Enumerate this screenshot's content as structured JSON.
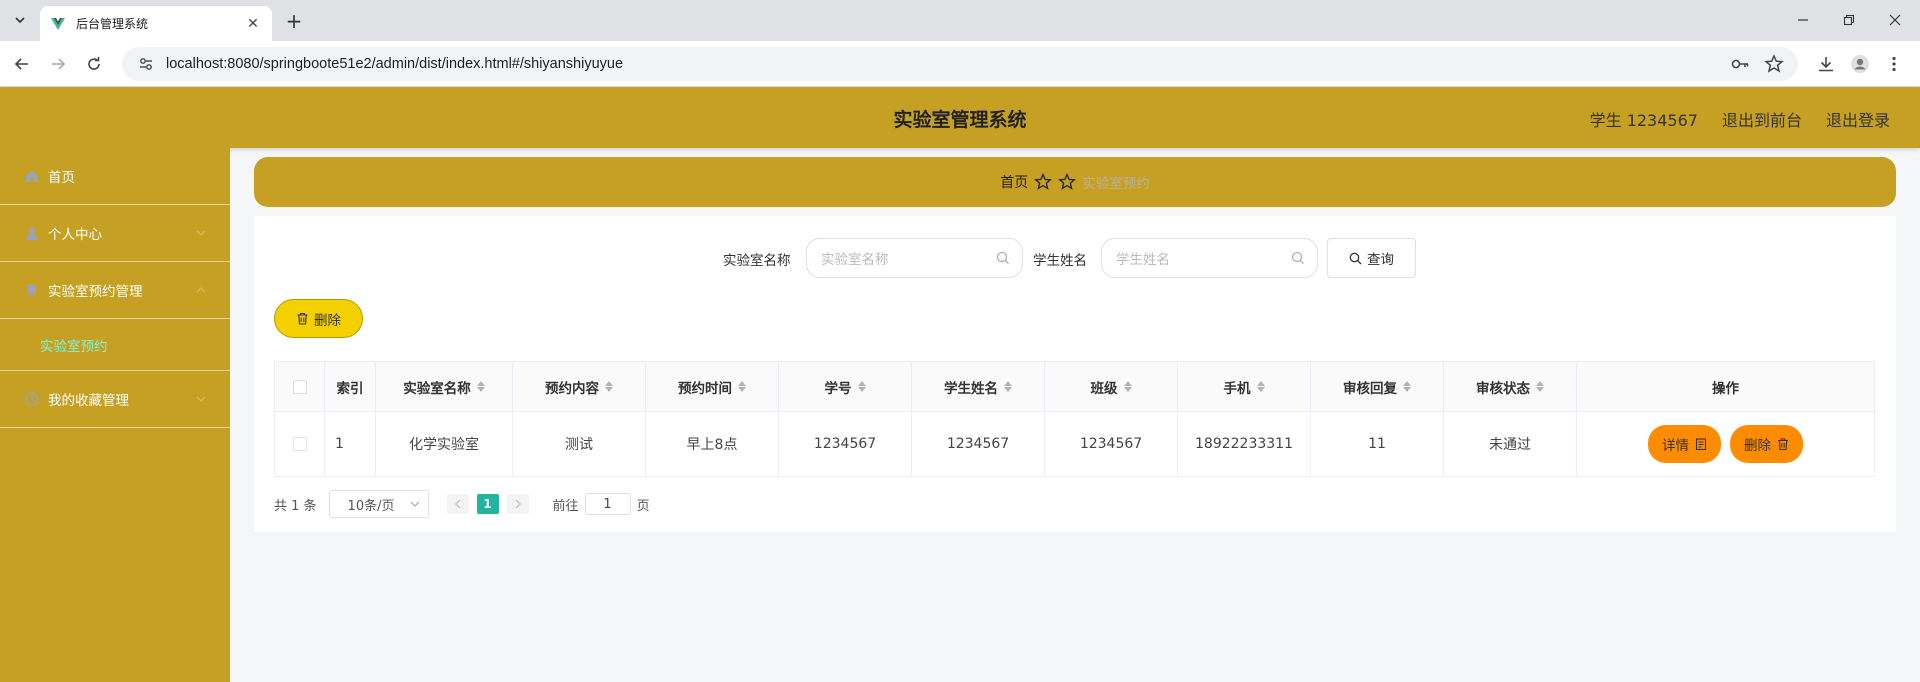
{
  "browser": {
    "tab_title": "后台管理系统",
    "url": "localhost:8080/springboote51e2/admin/dist/index.html#/shiyanshiyuyue"
  },
  "header": {
    "title": "实验室管理系统",
    "user": "学生 1234567",
    "to_front": "退出到前台",
    "logout": "退出登录",
    "bg_color": "#c5a022"
  },
  "sidebar": {
    "items": [
      {
        "label": "首页",
        "icon": "home-icon"
      },
      {
        "label": "个人中心",
        "icon": "user-icon"
      },
      {
        "label": "实验室预约管理",
        "icon": "book-icon"
      },
      {
        "label": "实验室预约",
        "icon": ""
      },
      {
        "label": "我的收藏管理",
        "icon": "clock-icon"
      }
    ]
  },
  "breadcrumb": {
    "home": "首页",
    "current": "实验室预约"
  },
  "search": {
    "lab_label": "实验室名称",
    "lab_placeholder": "实验室名称",
    "student_label": "学生姓名",
    "student_placeholder": "学生姓名",
    "query_button": "查询"
  },
  "toolbar": {
    "delete_button": "删除"
  },
  "table": {
    "columns": [
      "",
      "索引",
      "实验室名称",
      "预约内容",
      "预约时间",
      "学号",
      "学生姓名",
      "班级",
      "手机",
      "审核回复",
      "审核状态",
      "操作"
    ],
    "rows": [
      {
        "index": "1",
        "lab_name": "化学实验室",
        "content": "测试",
        "time": "早上8点",
        "student_no": "1234567",
        "student_name": "1234567",
        "class": "1234567",
        "phone": "18922233311",
        "reply": "11",
        "status": "未通过",
        "detail_button": "详情",
        "delete_button": "删除"
      }
    ]
  },
  "pagination": {
    "total": "共 1 条",
    "page_size": "10条/页",
    "current_page": "1",
    "goto_label": "前往",
    "goto_value": "1",
    "page_suffix": "页"
  }
}
